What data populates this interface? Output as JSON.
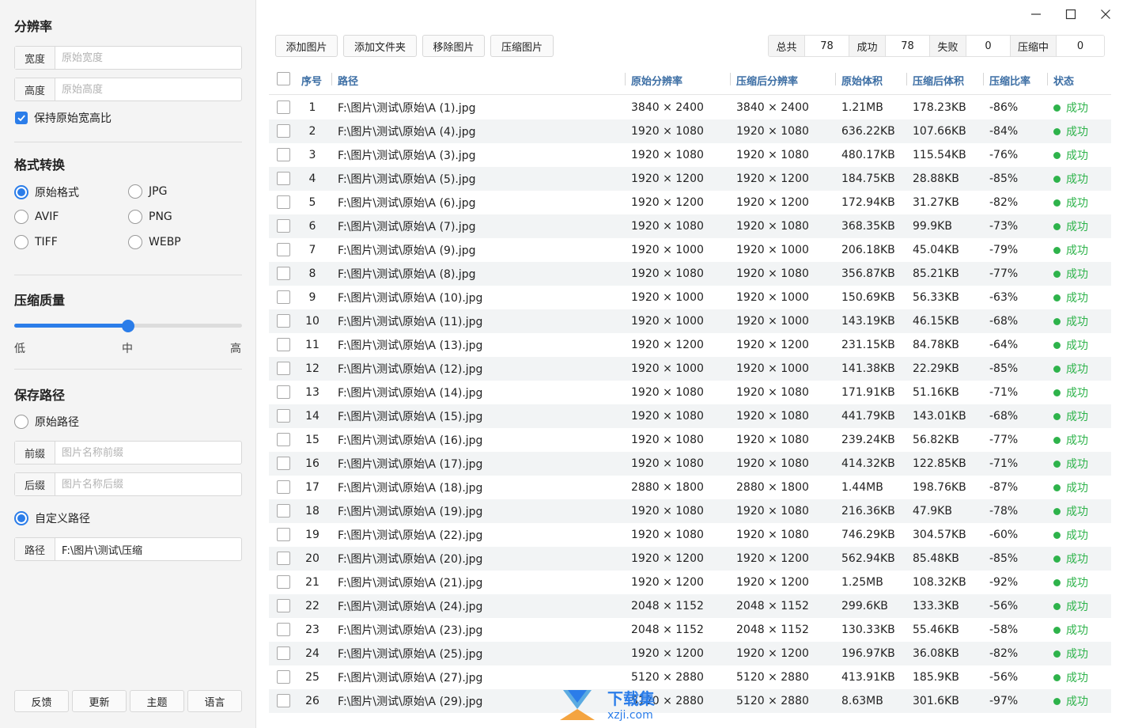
{
  "colors": {
    "accent": "#2b7de9",
    "success": "#2eb34b",
    "header_text": "#3c6ea4"
  },
  "sidebar": {
    "resolution": {
      "title": "分辨率",
      "width": {
        "label": "宽度",
        "placeholder": "原始宽度",
        "value": ""
      },
      "height": {
        "label": "高度",
        "placeholder": "原始高度",
        "value": ""
      },
      "keep_ratio": {
        "label": "保持原始宽高比",
        "checked": true
      }
    },
    "format": {
      "title": "格式转换",
      "options": [
        {
          "label": "原始格式",
          "selected": true
        },
        {
          "label": "JPG",
          "selected": false
        },
        {
          "label": "AVIF",
          "selected": false
        },
        {
          "label": "PNG",
          "selected": false
        },
        {
          "label": "TIFF",
          "selected": false
        },
        {
          "label": "WEBP",
          "selected": false
        }
      ]
    },
    "quality": {
      "title": "压缩质量",
      "value": 0.5,
      "low": "低",
      "mid": "中",
      "high": "高"
    },
    "save_path": {
      "title": "保存路径",
      "original": {
        "label": "原始路径",
        "selected": false
      },
      "prefix": {
        "label": "前缀",
        "placeholder": "图片名称前缀",
        "value": ""
      },
      "suffix": {
        "label": "后缀",
        "placeholder": "图片名称后缀",
        "value": ""
      },
      "custom": {
        "label": "自定义路径",
        "selected": true
      },
      "path": {
        "label": "路径",
        "value": "F:\\图片\\测试\\压缩"
      }
    },
    "footer_buttons": [
      "反馈",
      "更新",
      "主题",
      "语言"
    ]
  },
  "toolbar": {
    "buttons": [
      "添加图片",
      "添加文件夹",
      "移除图片",
      "压缩图片"
    ],
    "stats": {
      "total_label": "总共",
      "total": "78",
      "success_label": "成功",
      "success": "78",
      "fail_label": "失败",
      "fail": "0",
      "compressing_label": "压缩中",
      "compressing": "0"
    }
  },
  "table": {
    "columns": [
      "序号",
      "路径",
      "原始分辨率",
      "压缩后分辨率",
      "原始体积",
      "压缩后体积",
      "压缩比率",
      "状态"
    ],
    "rows": [
      [
        "1",
        "F:\\图片\\测试\\原始\\A (1).jpg",
        "3840 × 2400",
        "3840 × 2400",
        "1.21MB",
        "178.23KB",
        "-86%",
        "成功"
      ],
      [
        "2",
        "F:\\图片\\测试\\原始\\A (4).jpg",
        "1920 × 1080",
        "1920 × 1080",
        "636.22KB",
        "107.66KB",
        "-84%",
        "成功"
      ],
      [
        "3",
        "F:\\图片\\测试\\原始\\A (3).jpg",
        "1920 × 1080",
        "1920 × 1080",
        "480.17KB",
        "115.54KB",
        "-76%",
        "成功"
      ],
      [
        "4",
        "F:\\图片\\测试\\原始\\A (5).jpg",
        "1920 × 1200",
        "1920 × 1200",
        "184.75KB",
        "28.88KB",
        "-85%",
        "成功"
      ],
      [
        "5",
        "F:\\图片\\测试\\原始\\A (6).jpg",
        "1920 × 1200",
        "1920 × 1200",
        "172.94KB",
        "31.27KB",
        "-82%",
        "成功"
      ],
      [
        "6",
        "F:\\图片\\测试\\原始\\A (7).jpg",
        "1920 × 1080",
        "1920 × 1080",
        "368.35KB",
        "99.9KB",
        "-73%",
        "成功"
      ],
      [
        "7",
        "F:\\图片\\测试\\原始\\A (9).jpg",
        "1920 × 1000",
        "1920 × 1000",
        "206.18KB",
        "45.04KB",
        "-79%",
        "成功"
      ],
      [
        "8",
        "F:\\图片\\测试\\原始\\A (8).jpg",
        "1920 × 1080",
        "1920 × 1080",
        "356.87KB",
        "85.21KB",
        "-77%",
        "成功"
      ],
      [
        "9",
        "F:\\图片\\测试\\原始\\A (10).jpg",
        "1920 × 1000",
        "1920 × 1000",
        "150.69KB",
        "56.33KB",
        "-63%",
        "成功"
      ],
      [
        "10",
        "F:\\图片\\测试\\原始\\A (11).jpg",
        "1920 × 1000",
        "1920 × 1000",
        "143.19KB",
        "46.15KB",
        "-68%",
        "成功"
      ],
      [
        "11",
        "F:\\图片\\测试\\原始\\A (13).jpg",
        "1920 × 1200",
        "1920 × 1200",
        "231.15KB",
        "84.78KB",
        "-64%",
        "成功"
      ],
      [
        "12",
        "F:\\图片\\测试\\原始\\A (12).jpg",
        "1920 × 1000",
        "1920 × 1000",
        "141.38KB",
        "22.29KB",
        "-85%",
        "成功"
      ],
      [
        "13",
        "F:\\图片\\测试\\原始\\A (14).jpg",
        "1920 × 1080",
        "1920 × 1080",
        "171.91KB",
        "51.16KB",
        "-71%",
        "成功"
      ],
      [
        "14",
        "F:\\图片\\测试\\原始\\A (15).jpg",
        "1920 × 1080",
        "1920 × 1080",
        "441.79KB",
        "143.01KB",
        "-68%",
        "成功"
      ],
      [
        "15",
        "F:\\图片\\测试\\原始\\A (16).jpg",
        "1920 × 1080",
        "1920 × 1080",
        "239.24KB",
        "56.82KB",
        "-77%",
        "成功"
      ],
      [
        "16",
        "F:\\图片\\测试\\原始\\A (17).jpg",
        "1920 × 1080",
        "1920 × 1080",
        "414.32KB",
        "122.85KB",
        "-71%",
        "成功"
      ],
      [
        "17",
        "F:\\图片\\测试\\原始\\A (18).jpg",
        "2880 × 1800",
        "2880 × 1800",
        "1.44MB",
        "198.76KB",
        "-87%",
        "成功"
      ],
      [
        "18",
        "F:\\图片\\测试\\原始\\A (19).jpg",
        "1920 × 1080",
        "1920 × 1080",
        "216.36KB",
        "47.9KB",
        "-78%",
        "成功"
      ],
      [
        "19",
        "F:\\图片\\测试\\原始\\A (22).jpg",
        "1920 × 1080",
        "1920 × 1080",
        "746.29KB",
        "304.57KB",
        "-60%",
        "成功"
      ],
      [
        "20",
        "F:\\图片\\测试\\原始\\A (20).jpg",
        "1920 × 1200",
        "1920 × 1200",
        "562.94KB",
        "85.48KB",
        "-85%",
        "成功"
      ],
      [
        "21",
        "F:\\图片\\测试\\原始\\A (21).jpg",
        "1920 × 1200",
        "1920 × 1200",
        "1.25MB",
        "108.32KB",
        "-92%",
        "成功"
      ],
      [
        "22",
        "F:\\图片\\测试\\原始\\A (24).jpg",
        "2048 × 1152",
        "2048 × 1152",
        "299.6KB",
        "133.3KB",
        "-56%",
        "成功"
      ],
      [
        "23",
        "F:\\图片\\测试\\原始\\A (23).jpg",
        "2048 × 1152",
        "2048 × 1152",
        "130.33KB",
        "55.46KB",
        "-58%",
        "成功"
      ],
      [
        "24",
        "F:\\图片\\测试\\原始\\A (25).jpg",
        "1920 × 1200",
        "1920 × 1200",
        "196.97KB",
        "36.08KB",
        "-82%",
        "成功"
      ],
      [
        "25",
        "F:\\图片\\测试\\原始\\A (27).jpg",
        "5120 × 2880",
        "5120 × 2880",
        "413.91KB",
        "185.9KB",
        "-56%",
        "成功"
      ],
      [
        "26",
        "F:\\图片\\测试\\原始\\A (29).jpg",
        "5120 × 2880",
        "5120 × 2880",
        "8.63MB",
        "301.6KB",
        "-97%",
        "成功"
      ]
    ]
  },
  "watermark": {
    "text": "下载集",
    "url": "xzji.com"
  }
}
